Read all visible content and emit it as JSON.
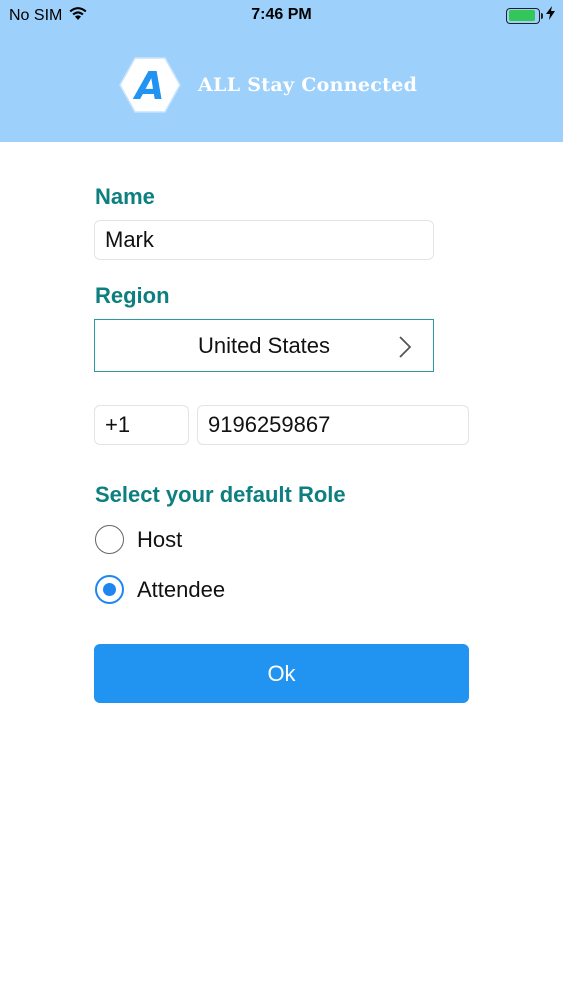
{
  "status_bar": {
    "carrier": "No SIM",
    "time": "7:46 PM",
    "battery_level": 0.9,
    "icons": [
      "wifi-icon",
      "battery-icon",
      "charging-bolt-icon"
    ]
  },
  "header": {
    "logo_letter": "A",
    "brand_name": "ALL Stay Connected",
    "background_color": "#9dd0fb"
  },
  "form": {
    "name_label": "Name",
    "name_value": "Mark",
    "region_label": "Region",
    "region_value": "United States",
    "country_code": "+1",
    "phone_number": "9196259867",
    "role_label": "Select your default Role",
    "roles": [
      {
        "label": "Host",
        "selected": false
      },
      {
        "label": "Attendee",
        "selected": true
      }
    ],
    "ok_label": "Ok"
  },
  "colors": {
    "label": "#0d7f80",
    "button": "#2193f0",
    "radio_selected": "#1e86f0"
  }
}
